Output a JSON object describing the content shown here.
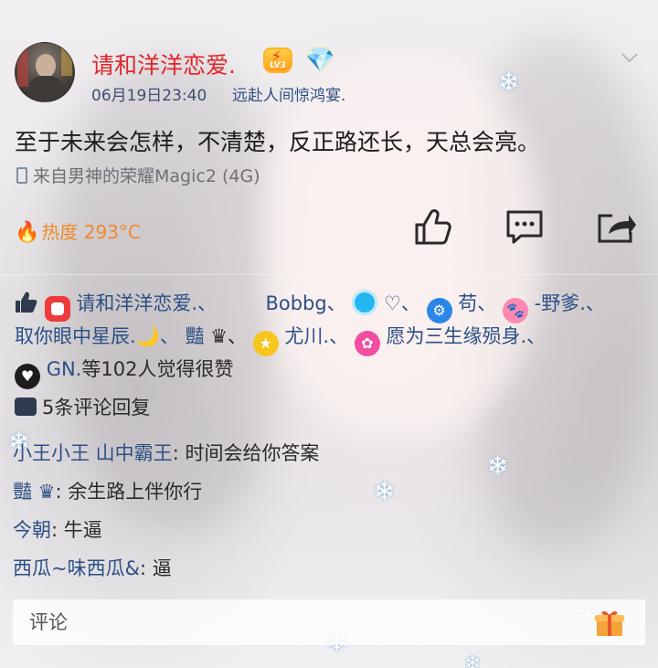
{
  "post": {
    "username": "请和洋洋恋爱.",
    "level_badge": "LV3",
    "time": "06月19日23:40",
    "signature": "远赴人间惊鸿宴.",
    "text": "至于未来会怎样，不清楚，反正路还长，天总会亮。",
    "device": "来自男神的荣耀Magic2 (4G)",
    "heat": "热度 293°C"
  },
  "icons": {
    "avatar": "avatar",
    "level": "lightning-badge-icon",
    "vip": "diamond-badge-icon",
    "menu": "chevron-down-icon",
    "like": "thumbs-up-icon",
    "comment": "comment-bubble-icon",
    "share": "share-arrow-icon",
    "fire": "fire-icon",
    "gift": "gift-icon"
  },
  "likes": {
    "line1": {
      "u1": "请和洋洋恋爱.、",
      "u2": "Bobbg、",
      "u3": "♡、",
      "u4": "苟、",
      "u5": "-野爹.、"
    },
    "line2": {
      "u6": "取你眼中星辰.🌙、",
      "u7": "豔",
      "u7_crown": "♛、",
      "u8": "尤川.、",
      "u9": "愿为三生缘殒身.、"
    },
    "line3": {
      "u10": "GN.",
      "summary": "等102人觉得很赞"
    }
  },
  "comments": {
    "header": "5条评论回复",
    "items": [
      {
        "author": "小王小王 山中霸王",
        "text": ": 时间会给你答案"
      },
      {
        "author": "豔  ♛",
        "text": ": 余生路上伴你行"
      },
      {
        "author": "今朝",
        "text": ": 牛逼"
      },
      {
        "author": "西瓜~味西瓜&",
        "text": ": 逼"
      }
    ]
  },
  "input": {
    "placeholder": "评论"
  },
  "colors": {
    "username": "#e0262b",
    "link": "#2c4f86",
    "heat": "#f08a2a",
    "text": "#1c1c1c"
  }
}
